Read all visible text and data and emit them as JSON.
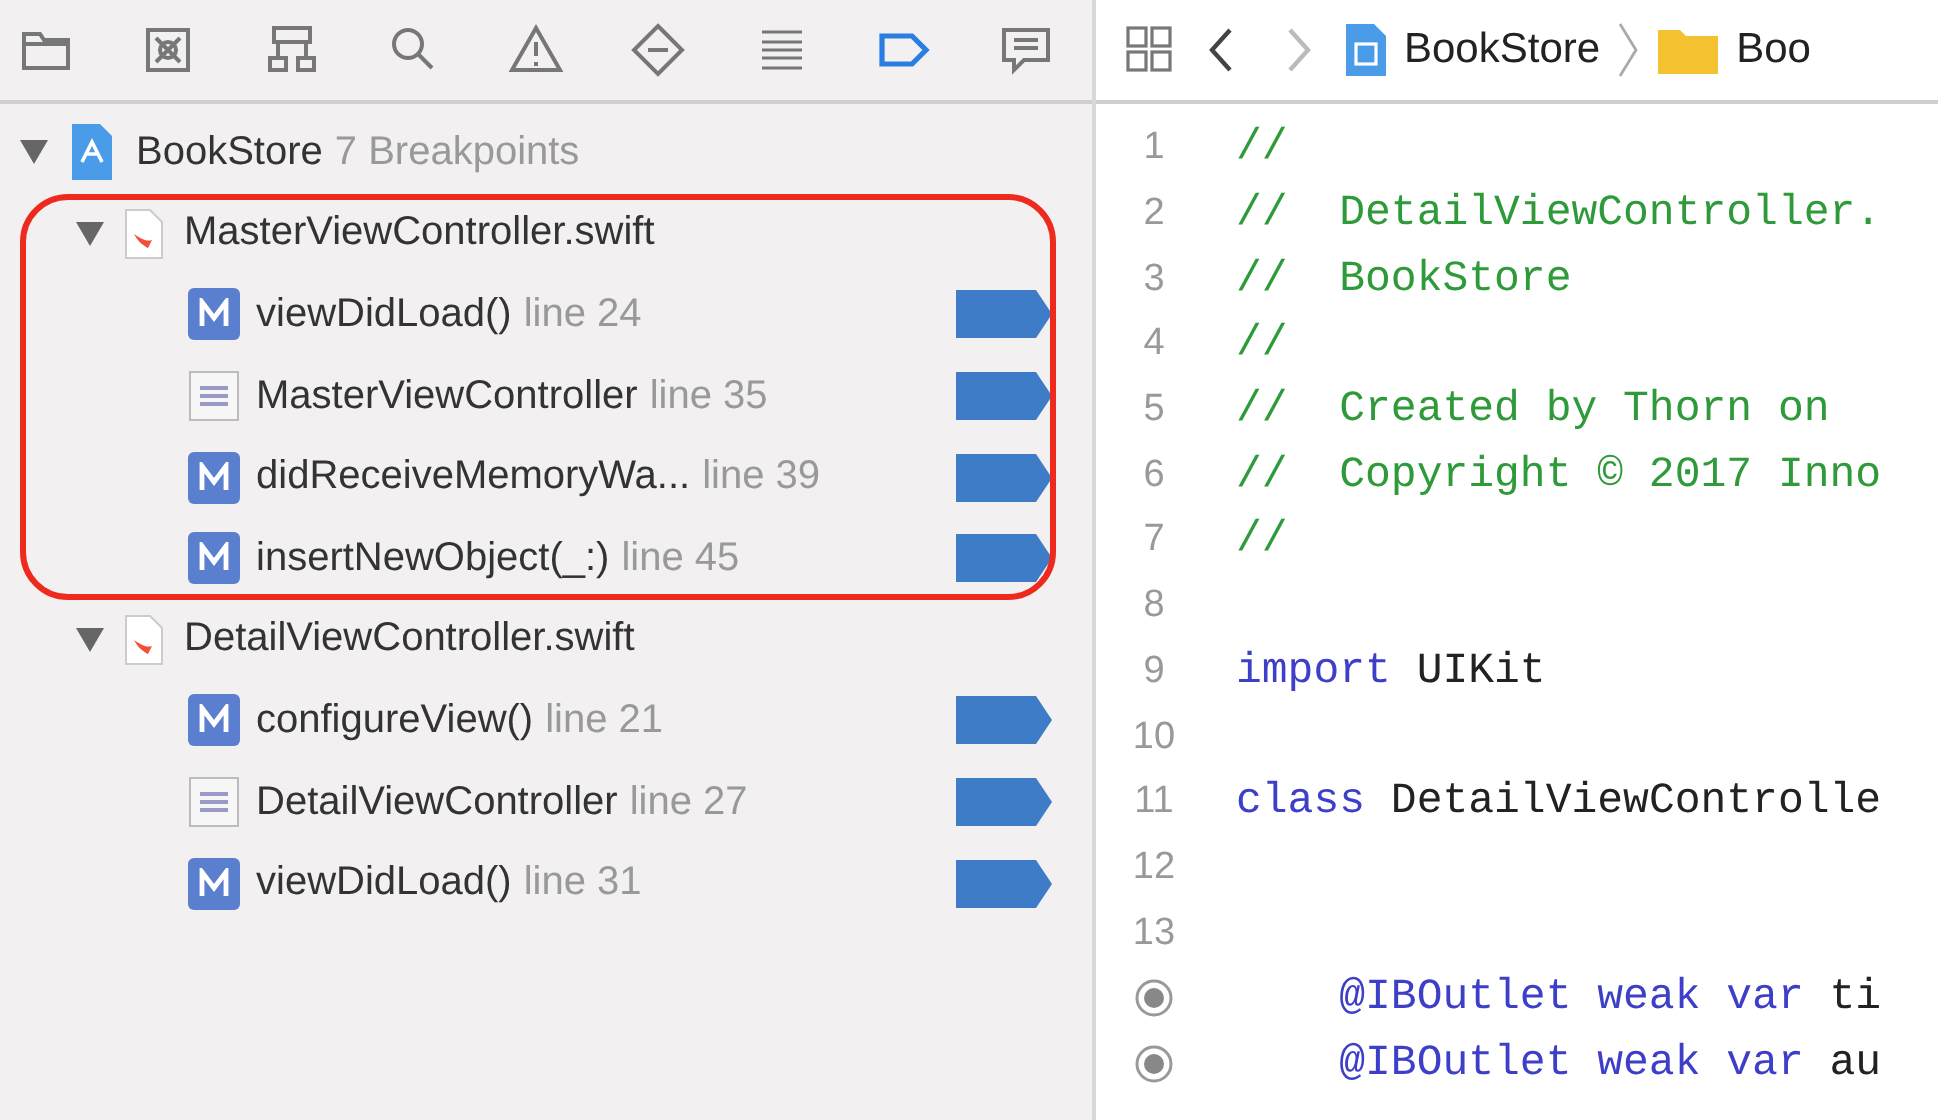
{
  "navigator_tabs": [
    {
      "kind": "folder",
      "selected": false
    },
    {
      "kind": "symbol",
      "selected": false
    },
    {
      "kind": "hierarchy",
      "selected": false
    },
    {
      "kind": "search",
      "selected": false
    },
    {
      "kind": "warning",
      "selected": false
    },
    {
      "kind": "test",
      "selected": false
    },
    {
      "kind": "debug",
      "selected": false
    },
    {
      "kind": "breakpoint",
      "selected": true
    },
    {
      "kind": "report",
      "selected": false
    }
  ],
  "project": {
    "name": "BookStore",
    "count": "7 Breakpoints",
    "expanded": true,
    "files": [
      {
        "name": "MasterViewController.swift",
        "expanded": true,
        "highlighted": true,
        "breakpoints": [
          {
            "kind": "method",
            "name": "viewDidLoad()",
            "location": "line 24",
            "enabled": true
          },
          {
            "kind": "class",
            "name": "MasterViewController",
            "location": "line 35",
            "enabled": true
          },
          {
            "kind": "method",
            "name": "didReceiveMemoryWa...",
            "location": "line 39",
            "enabled": true
          },
          {
            "kind": "method",
            "name": "insertNewObject(_:)",
            "location": "line 45",
            "enabled": true
          }
        ]
      },
      {
        "name": "DetailViewController.swift",
        "expanded": true,
        "highlighted": false,
        "breakpoints": [
          {
            "kind": "method",
            "name": "configureView()",
            "location": "line 21",
            "enabled": true
          },
          {
            "kind": "class",
            "name": "DetailViewController",
            "location": "line 27",
            "enabled": true
          },
          {
            "kind": "method",
            "name": "viewDidLoad()",
            "location": "line 31",
            "enabled": true
          }
        ]
      }
    ]
  },
  "editor": {
    "back_disabled": false,
    "forward_disabled": true,
    "breadcrumbs": [
      {
        "kind": "project",
        "label": "BookStore"
      },
      {
        "kind": "folder",
        "label": "Boo"
      }
    ],
    "lines": [
      {
        "number": "1",
        "tokens": [
          {
            "kind": "comment",
            "text": "//"
          }
        ]
      },
      {
        "number": "2",
        "tokens": [
          {
            "kind": "comment",
            "text": "//  DetailViewController."
          }
        ]
      },
      {
        "number": "3",
        "tokens": [
          {
            "kind": "comment",
            "text": "//  BookStore"
          }
        ]
      },
      {
        "number": "4",
        "tokens": [
          {
            "kind": "comment",
            "text": "//"
          }
        ]
      },
      {
        "number": "5",
        "tokens": [
          {
            "kind": "comment",
            "text": "//  Created by Thorn on"
          }
        ]
      },
      {
        "number": "6",
        "tokens": [
          {
            "kind": "comment",
            "text": "//  Copyright © 2017 Inno"
          }
        ]
      },
      {
        "number": "7",
        "tokens": [
          {
            "kind": "comment",
            "text": "//"
          }
        ]
      },
      {
        "number": "8"
      },
      {
        "number": "9",
        "tokens": [
          {
            "kind": "keyword",
            "text": "import"
          },
          {
            "kind": "plain",
            "text": " UIKit"
          }
        ]
      },
      {
        "number": "10"
      },
      {
        "number": "11",
        "tokens": [
          {
            "kind": "keyword",
            "text": "class"
          },
          {
            "kind": "plain",
            "text": " DetailViewControlle"
          }
        ]
      },
      {
        "number": "12"
      },
      {
        "number": "13"
      },
      {
        "outlet_connected": true,
        "tokens": [
          {
            "kind": "keyword",
            "text": "    @IBOutlet weak var"
          },
          {
            "kind": "plain",
            "text": " ti"
          }
        ]
      },
      {
        "outlet_connected": true,
        "tokens": [
          {
            "kind": "keyword",
            "text": "    @IBOutlet weak var"
          },
          {
            "kind": "plain",
            "text": " au"
          }
        ]
      }
    ]
  }
}
